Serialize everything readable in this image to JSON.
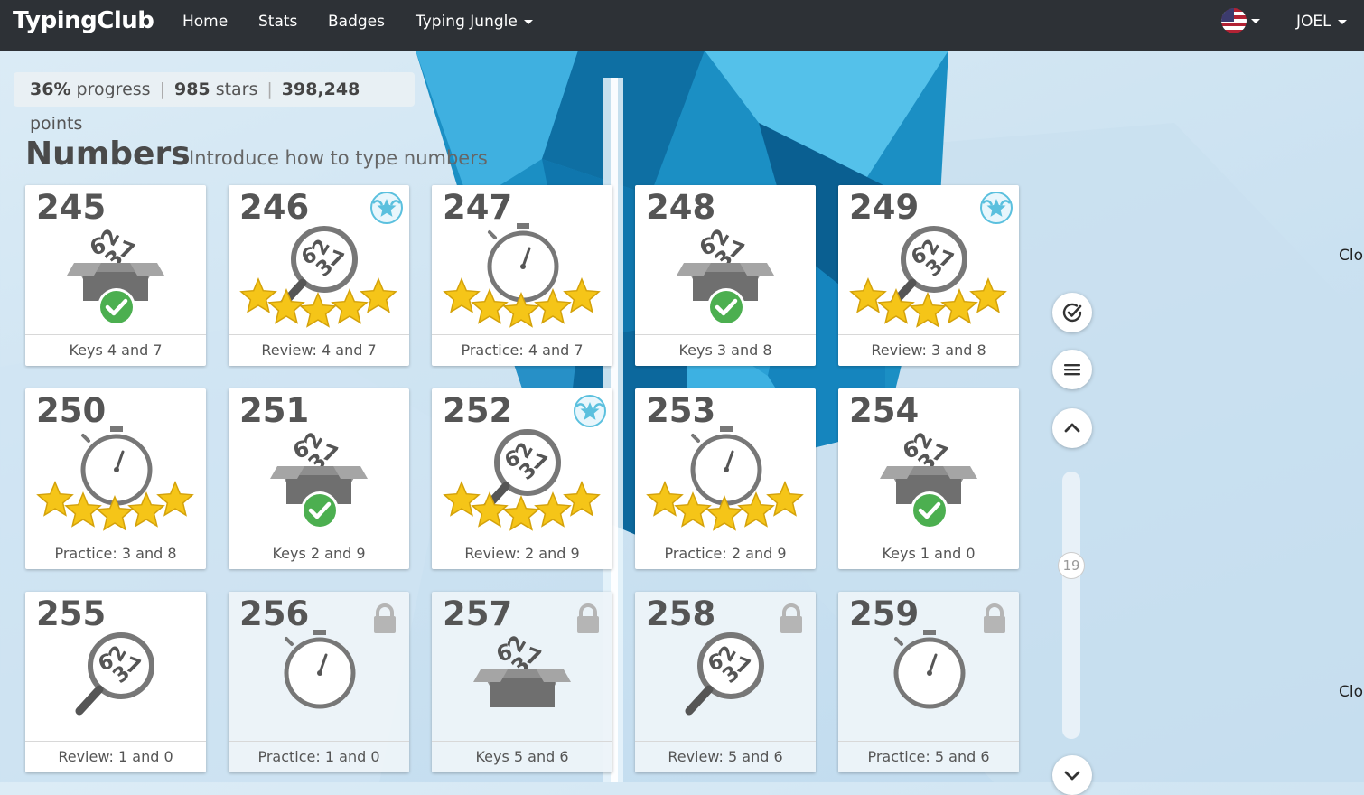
{
  "app": {
    "brand": "TypingClub"
  },
  "nav": {
    "home": "Home",
    "stats": "Stats",
    "badges": "Badges",
    "jungle": "Typing Jungle",
    "user": "JOEL",
    "language_icon": "us-flag-icon"
  },
  "summary": {
    "progress_value": "36%",
    "progress_label": "progress",
    "stars_value": "985",
    "stars_label": "stars",
    "points_value": "398,248",
    "points_label": "points"
  },
  "section": {
    "title": "Numbers",
    "subtitle": "Introduce how to type numbers"
  },
  "lessons": [
    {
      "num": "245",
      "label": "Keys 4 and 7",
      "kind": "box",
      "status": "done",
      "stars": 0,
      "badge": false,
      "locked": false
    },
    {
      "num": "246",
      "label": "Review: 4 and 7",
      "kind": "magnifier",
      "status": "stars",
      "stars": 5,
      "badge": true,
      "locked": false
    },
    {
      "num": "247",
      "label": "Practice: 4 and 7",
      "kind": "timer",
      "status": "stars",
      "stars": 5,
      "badge": false,
      "locked": false
    },
    {
      "num": "248",
      "label": "Keys 3 and 8",
      "kind": "box",
      "status": "done",
      "stars": 0,
      "badge": false,
      "locked": false
    },
    {
      "num": "249",
      "label": "Review: 3 and 8",
      "kind": "magnifier",
      "status": "stars",
      "stars": 5,
      "badge": true,
      "locked": false
    },
    {
      "num": "250",
      "label": "Practice: 3 and 8",
      "kind": "timer",
      "status": "stars",
      "stars": 5,
      "badge": false,
      "locked": false
    },
    {
      "num": "251",
      "label": "Keys 2 and 9",
      "kind": "box",
      "status": "done",
      "stars": 0,
      "badge": false,
      "locked": false
    },
    {
      "num": "252",
      "label": "Review: 2 and 9",
      "kind": "magnifier",
      "status": "stars",
      "stars": 5,
      "badge": true,
      "locked": false
    },
    {
      "num": "253",
      "label": "Practice: 2 and 9",
      "kind": "timer",
      "status": "stars",
      "stars": 5,
      "badge": false,
      "locked": false
    },
    {
      "num": "254",
      "label": "Keys 1 and 0",
      "kind": "box",
      "status": "done",
      "stars": 0,
      "badge": false,
      "locked": false
    },
    {
      "num": "255",
      "label": "Review: 1 and 0",
      "kind": "magnifier",
      "status": "none",
      "stars": 0,
      "badge": false,
      "locked": false
    },
    {
      "num": "256",
      "label": "Practice: 1 and 0",
      "kind": "timer",
      "status": "none",
      "stars": 0,
      "badge": false,
      "locked": true
    },
    {
      "num": "257",
      "label": "Keys 5 and 6",
      "kind": "box",
      "status": "none",
      "stars": 0,
      "badge": false,
      "locked": true
    },
    {
      "num": "258",
      "label": "Review: 5 and 6",
      "kind": "magnifier",
      "status": "none",
      "stars": 0,
      "badge": false,
      "locked": true
    },
    {
      "num": "259",
      "label": "Practice: 5 and 6",
      "kind": "timer",
      "status": "none",
      "stars": 0,
      "badge": false,
      "locked": true
    }
  ],
  "sidebar": {
    "check_icon": "check-circle-icon",
    "menu_icon": "menu-icon",
    "up_icon": "chevron-up-icon",
    "down_icon": "chevron-down-icon",
    "scroll_value": "19"
  },
  "edge_text": {
    "top": "Clo",
    "bottom": "Clo"
  },
  "colors": {
    "topbar": "#2d3136",
    "star": "#f5c518",
    "check": "#4caf50",
    "badge": "#5bc0de",
    "ice": "#1b8fc4"
  }
}
